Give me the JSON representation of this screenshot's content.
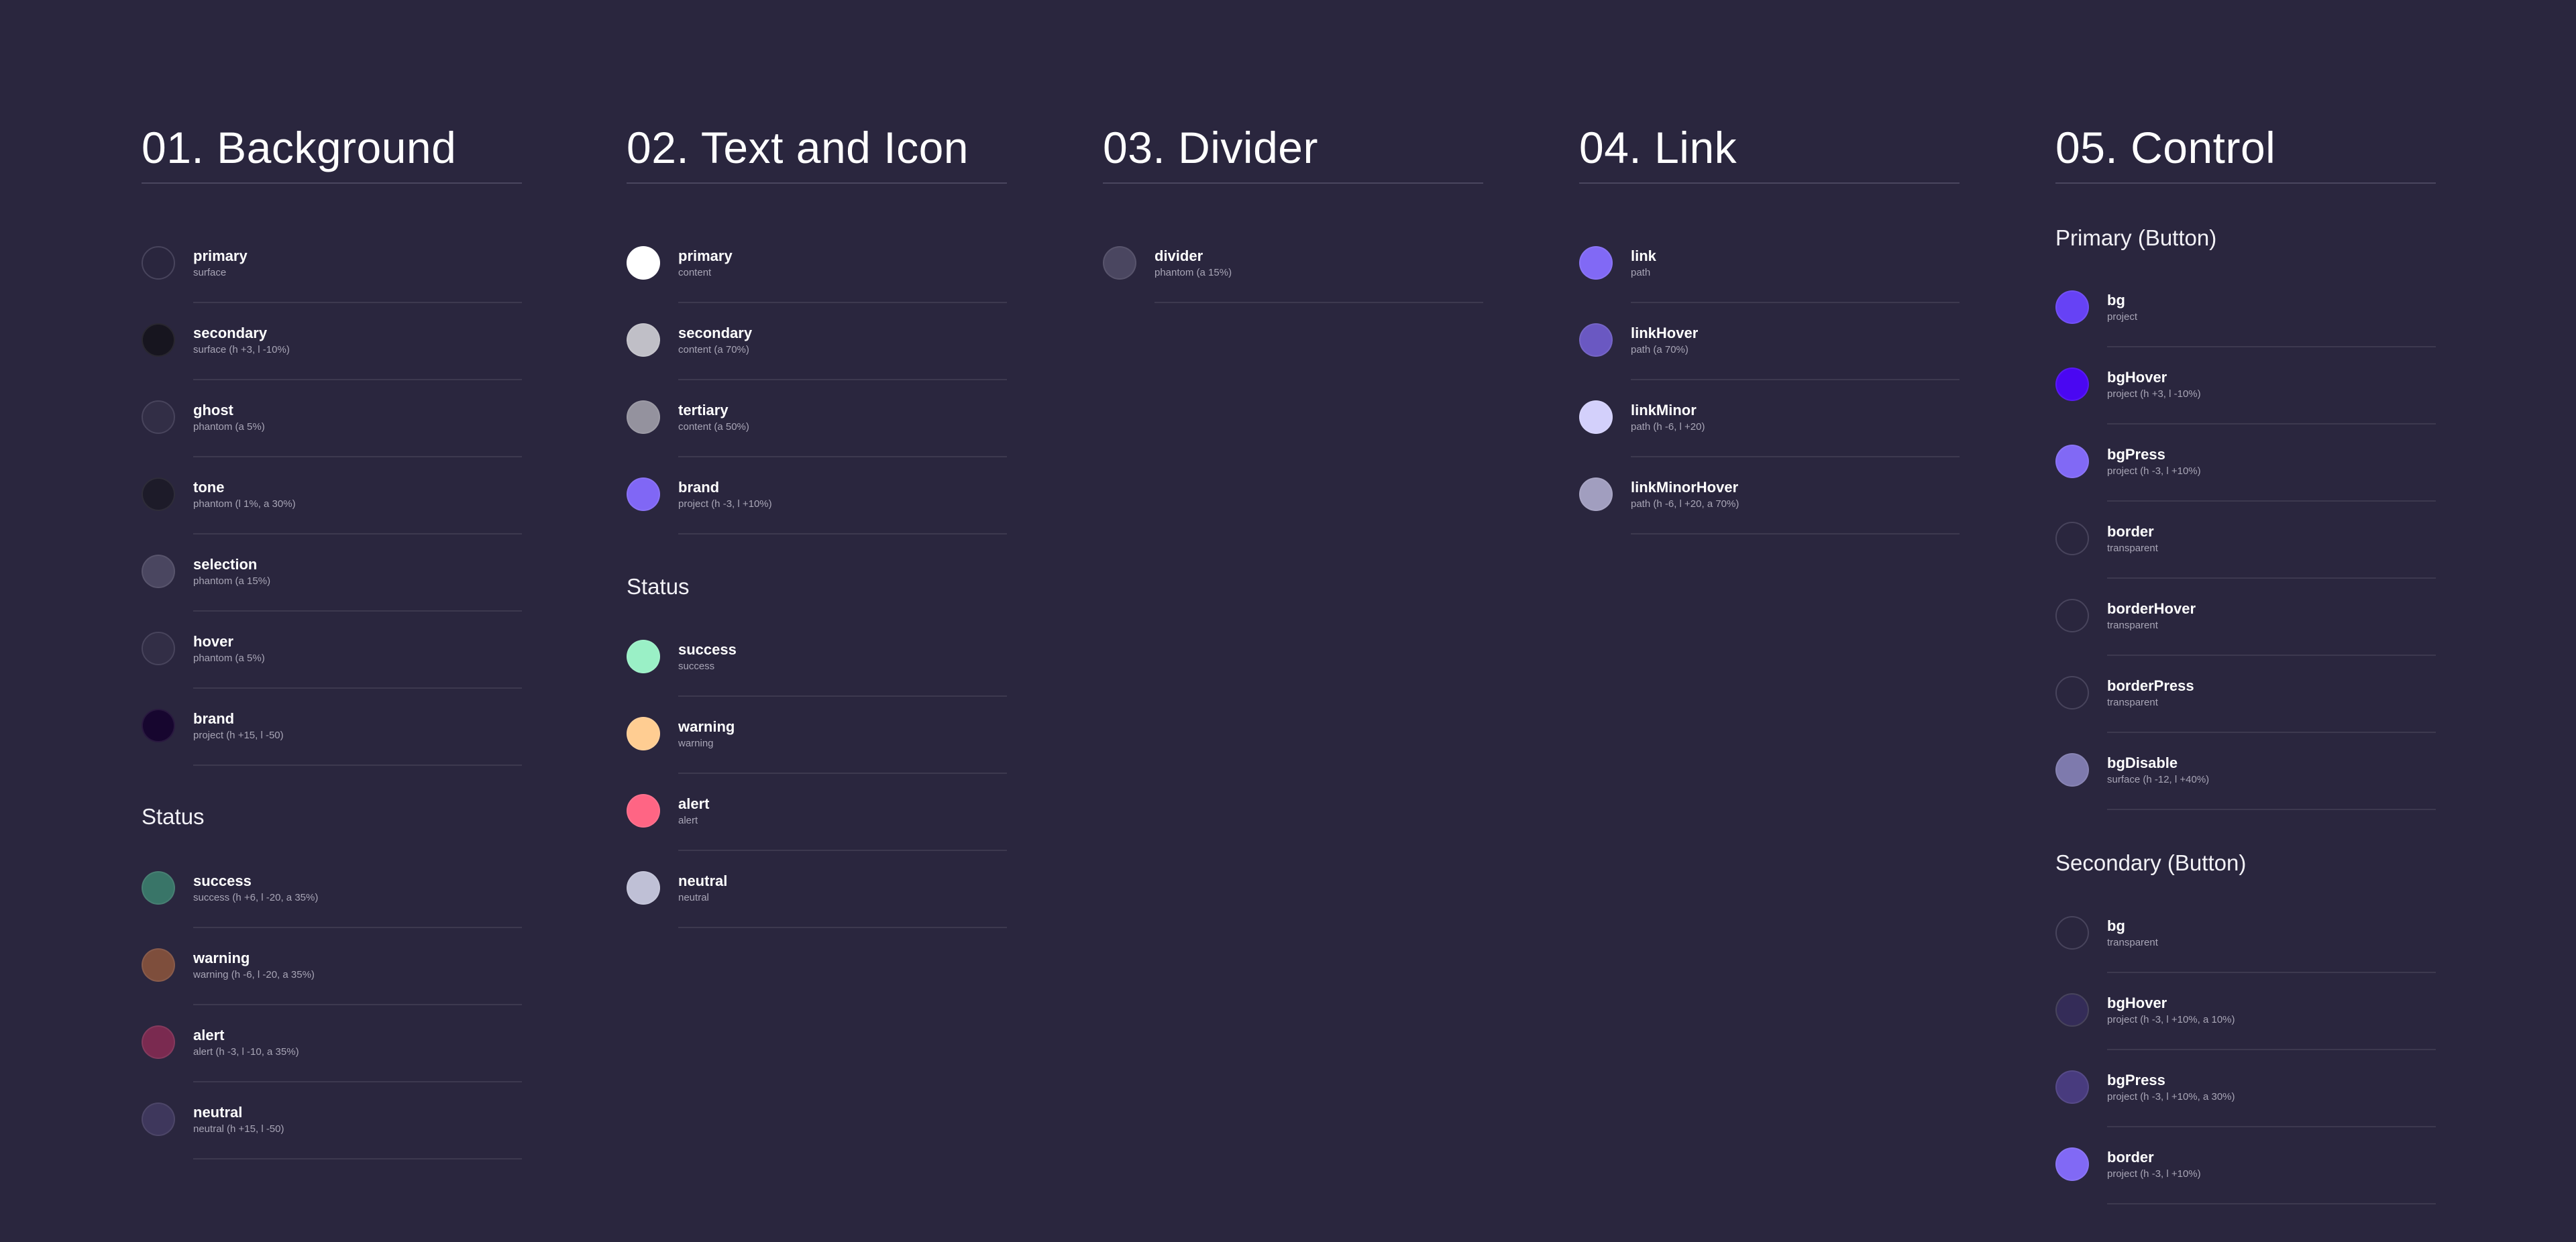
{
  "colors": {
    "page_bg": "#2a263e"
  },
  "columns": [
    {
      "title": "01. Background",
      "groups": [
        {
          "heading": null,
          "items": [
            {
              "name": "primary",
              "sub": "surface",
              "swatch": "transparent",
              "outline": true
            },
            {
              "name": "secondary",
              "sub": "surface (h +3, l -10%)",
              "swatch": "#17151f",
              "outline": false
            },
            {
              "name": "ghost",
              "sub": "phantom (a 5%)",
              "swatch": "#322e46",
              "outline": true
            },
            {
              "name": "tone",
              "sub": "phantom (l 1%, a 30%)",
              "swatch": "#1d1b29",
              "outline": false
            },
            {
              "name": "selection",
              "sub": "phantom (a 15%)",
              "swatch": "#4a4660",
              "outline": false
            },
            {
              "name": "hover",
              "sub": "phantom (a 5%)",
              "swatch": "#322e46",
              "outline": true
            },
            {
              "name": "brand",
              "sub": "project (h +15, l -50)",
              "swatch": "#17062f",
              "outline": false
            }
          ]
        },
        {
          "heading": "Status",
          "items": [
            {
              "name": "success",
              "sub": "success (h +6, l -20, a 35%)",
              "swatch": "#397568",
              "outline": false
            },
            {
              "name": "warning",
              "sub": "warning (h -6, l -20, a 35%)",
              "swatch": "#7e4e3c",
              "outline": false
            },
            {
              "name": "alert",
              "sub": "alert (h -3, l -10, a 35%)",
              "swatch": "#7a2a50",
              "outline": false
            },
            {
              "name": "neutral",
              "sub": "neutral (h +15, l -50)",
              "swatch": "#3e375c",
              "outline": false
            }
          ]
        }
      ]
    },
    {
      "title": "02. Text and Icon",
      "groups": [
        {
          "heading": null,
          "items": [
            {
              "name": "primary",
              "sub": "content",
              "swatch": "#ffffff",
              "outline": false
            },
            {
              "name": "secondary",
              "sub": "content (a 70%)",
              "swatch": "#c0bfc7",
              "outline": false
            },
            {
              "name": "tertiary",
              "sub": "content (a 50%)",
              "swatch": "#94929e",
              "outline": false
            },
            {
              "name": "brand",
              "sub": "project (h -3, l +10%)",
              "swatch": "#8067f5",
              "outline": false
            }
          ]
        },
        {
          "heading": "Status",
          "items": [
            {
              "name": "success",
              "sub": "success",
              "swatch": "#9af0c6",
              "outline": false
            },
            {
              "name": "warning",
              "sub": "warning",
              "swatch": "#ffcd92",
              "outline": false
            },
            {
              "name": "alert",
              "sub": "alert",
              "swatch": "#ff6584",
              "outline": false
            },
            {
              "name": "neutral",
              "sub": "neutral",
              "swatch": "#bfc0d6",
              "outline": false
            }
          ]
        }
      ]
    },
    {
      "title": "03. Divider",
      "groups": [
        {
          "heading": null,
          "items": [
            {
              "name": "divider",
              "sub": "phantom (a 15%)",
              "swatch": "#4a4660",
              "outline": false
            }
          ]
        }
      ]
    },
    {
      "title": "04. Link",
      "groups": [
        {
          "heading": null,
          "items": [
            {
              "name": "link",
              "sub": "path",
              "swatch": "#8169f5",
              "outline": false
            },
            {
              "name": "linkHover",
              "sub": "path (a 70%)",
              "swatch": "#6a58c2",
              "outline": false
            },
            {
              "name": "linkMinor",
              "sub": "path (h -6, l +20)",
              "swatch": "#d3d0fb",
              "outline": false
            },
            {
              "name": "linkMinorHover",
              "sub": "path (h -6, l +20, a 70%)",
              "swatch": "#a19ebf",
              "outline": false
            }
          ]
        }
      ]
    },
    {
      "title": "05. Control",
      "groups": [
        {
          "heading": "Primary (Button)",
          "items": [
            {
              "name": "bg",
              "sub": "project",
              "swatch": "#6642f5",
              "outline": false
            },
            {
              "name": "bgHover",
              "sub": "project (h +3, l -10%)",
              "swatch": "#4a07f2",
              "outline": false
            },
            {
              "name": "bgPress",
              "sub": "project (h -3, l +10%)",
              "swatch": "#8169f5",
              "outline": false
            },
            {
              "name": "border",
              "sub": "transparent",
              "swatch": "transparent",
              "outline": true
            },
            {
              "name": "borderHover",
              "sub": "transparent",
              "swatch": "transparent",
              "outline": true
            },
            {
              "name": "borderPress",
              "sub": "transparent",
              "swatch": "transparent",
              "outline": true
            },
            {
              "name": "bgDisable",
              "sub": "surface (h -12, l +40%)",
              "swatch": "#7e7aad",
              "outline": false
            }
          ]
        },
        {
          "heading": "Secondary (Button)",
          "items": [
            {
              "name": "bg",
              "sub": "transparent",
              "swatch": "transparent",
              "outline": true
            },
            {
              "name": "bgHover",
              "sub": "project (h -3, l +10%, a 10%)",
              "swatch": "#342c58",
              "outline": true
            },
            {
              "name": "bgPress",
              "sub": "project (h -3, l +10%, a 30%)",
              "swatch": "#483b7e",
              "outline": false
            },
            {
              "name": "border",
              "sub": "project (h -3, l +10%)",
              "swatch": "#8169f5",
              "outline": false
            }
          ]
        }
      ]
    }
  ]
}
